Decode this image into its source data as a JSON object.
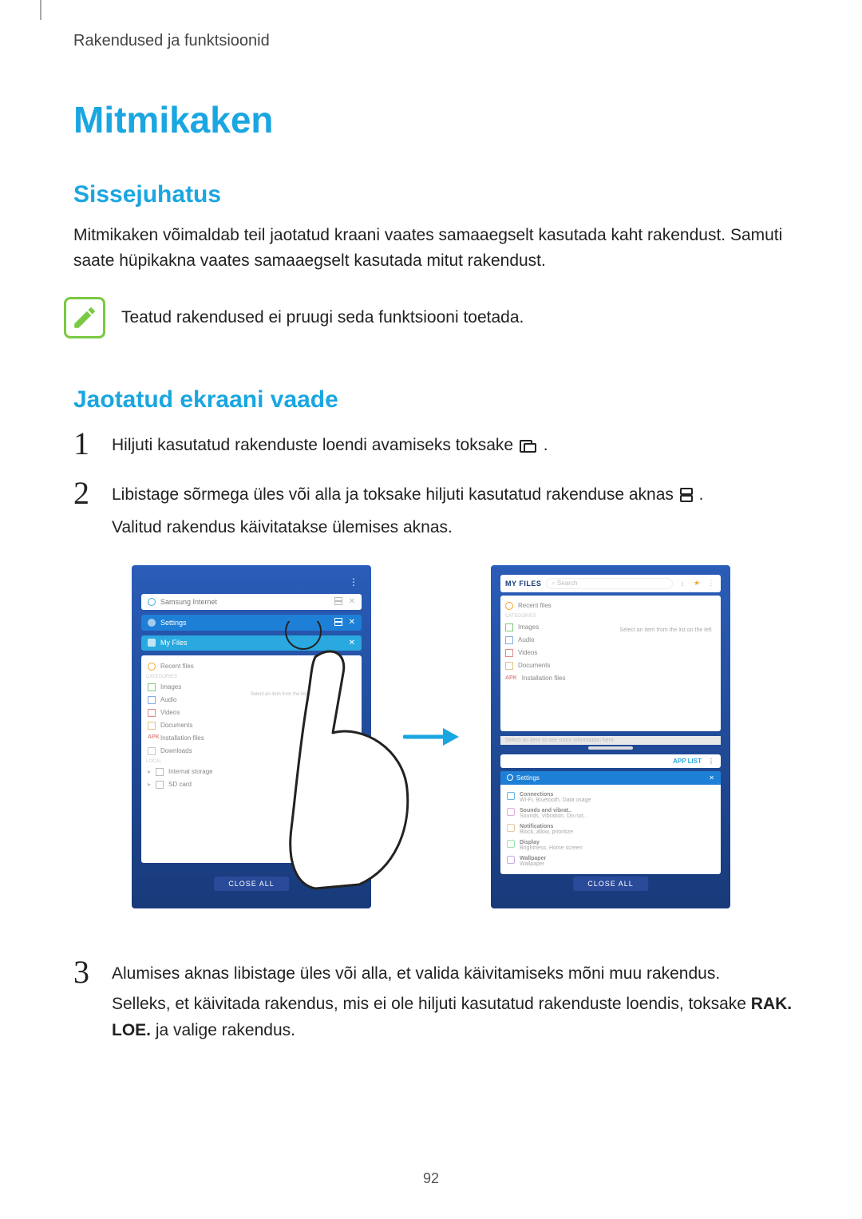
{
  "running_head": "Rakendused ja funktsioonid",
  "title": "Mitmikaken",
  "section_intro_title": "Sissejuhatus",
  "intro_body": "Mitmikaken võimaldab teil jaotatud kraani vaates samaaegselt kasutada kaht rakendust. Samuti saate hüpikakna vaates samaaegselt kasutada mitut rakendust.",
  "note_text": "Teatud rakendused ei pruugi seda funktsiooni toetada.",
  "section_split_title": "Jaotatud ekraani vaade",
  "steps": {
    "s1_num": "1",
    "s1_text": "Hiljuti kasutatud rakenduste loendi avamiseks toksake ",
    "s1_after": ".",
    "s2_num": "2",
    "s2_text_a": "Libistage sõrmega üles või alla ja toksake hiljuti kasutatud rakenduse aknas ",
    "s2_text_b": ".",
    "s2_text_c": "Valitud rakendus käivitatakse ülemises aknas.",
    "s3_num": "3",
    "s3_text_a": "Alumises aknas libistage üles või alla, et valida käivitamiseks mõni muu rakendus.",
    "s3_text_b_pre": "Selleks, et käivitada rakendus, mis ei ole hiljuti kasutatud rakenduste loendis, toksake ",
    "s3_bold": "RAK. LOE.",
    "s3_text_b_post": " ja valige rakendus."
  },
  "figure": {
    "left": {
      "card1": "Samsung Internet",
      "card2": "Settings",
      "card3": "My Files",
      "recent_files": "Recent files",
      "categories_label": "CATEGORIES",
      "rows": [
        "Images",
        "Audio",
        "Videos",
        "Documents",
        "Installation files",
        "Downloads"
      ],
      "storage_label": "LOCAL",
      "storage_rows": [
        "Internal storage",
        "SD card"
      ],
      "hint": "Select an item from the list on the left",
      "close_all": "CLOSE ALL"
    },
    "right": {
      "myfiles": "MY FILES",
      "search_placeholder": "Search",
      "recent_files": "Recent files",
      "categories_label": "CATEGORIES",
      "rows": [
        "Images",
        "Audio",
        "Videos",
        "Documents",
        "Installation files"
      ],
      "hint2": "Select an item from the list on the left",
      "sep": "Select an item to see more information here.",
      "applist": "APP LIST",
      "settings_head": "Settings",
      "settings_rows": [
        {
          "t": "Connections",
          "s": "Wi-Fi, Bluetooth, Data usage"
        },
        {
          "t": "Sounds and vibrat..",
          "s": "Sounds, Vibration, Do not..."
        },
        {
          "t": "Notifications",
          "s": "Block, allow, prioritize"
        },
        {
          "t": "Display",
          "s": "Brightness, Home screen"
        },
        {
          "t": "Wallpaper",
          "s": "Wallpaper"
        }
      ],
      "close_all": "CLOSE ALL"
    }
  },
  "page_number": "92"
}
